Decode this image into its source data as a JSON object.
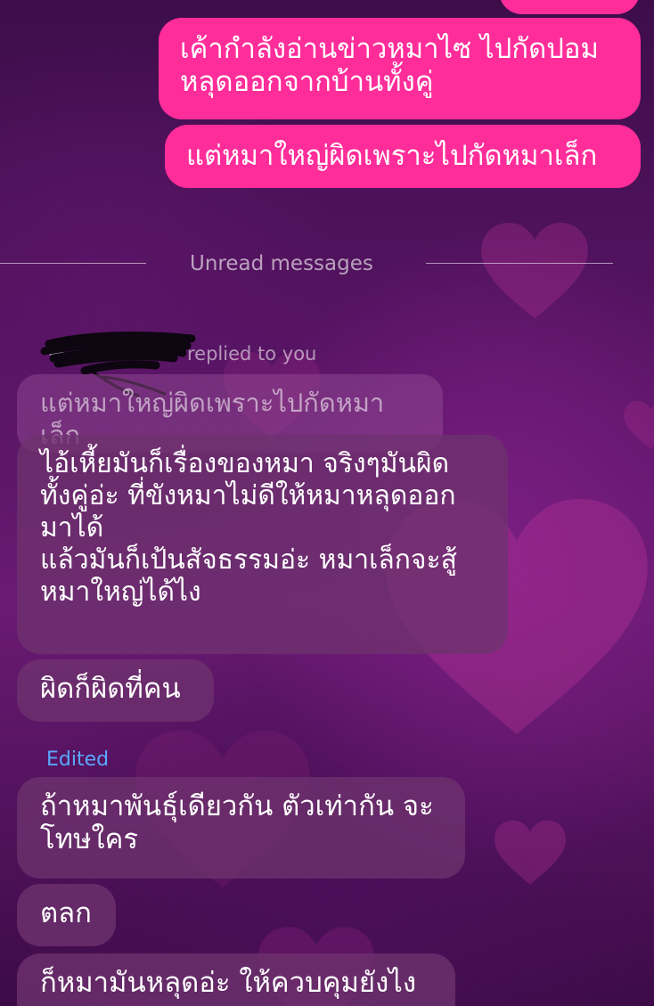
{
  "conversation": {
    "sent_messages": [
      {
        "text": "เค้ากำลังอ่านข่าวหมาไซ ไปกัดปอม\nหลุดออกจากบ้านทั้งคู่"
      },
      {
        "text": "แต่หมาใหญ่ผิดเพราะไปกัดหมาเล็ก"
      }
    ],
    "unread_divider": "Unread messages",
    "reply_info": {
      "label": "replied to you",
      "quoted_text": "แต่หมาใหญ่ผิดเพราะไปกัดหมาเล็ก"
    },
    "received_messages": [
      {
        "text": "ไอ้เหี้ยมันก็เรื่องของหมา จริงๆมันผิด\nทั้งคู่อ่ะ ที่ขังหมาไม่ดีให้หมาหลุดออก\nมาได้\nแล้วมันก็เป้นสัจธรรมอ่ะ หมาเล็กจะสู้\nหมาใหญ่ได้ไง"
      },
      {
        "text": "ผิดก็ผิดที่คน"
      },
      {
        "text": "ถ้าหมาพันธุ์เดียวกัน ตัวเท่ากัน จะ\nโทษใคร"
      },
      {
        "text": "ตลก"
      },
      {
        "text": "ก็หมามันหลุดอ่ะ ให้ควบคุมยังไง"
      }
    ],
    "edited_label": "Edited"
  },
  "colors": {
    "sent_bubble": "#ff2d9a",
    "received_bubble": "#6e326e",
    "edited_label": "#5aa8ff",
    "background_top": "#3d0d4a",
    "background_mid": "#6a1a73"
  },
  "icons": {
    "reply": "reply-arrow-icon",
    "background": "heart-icon"
  }
}
